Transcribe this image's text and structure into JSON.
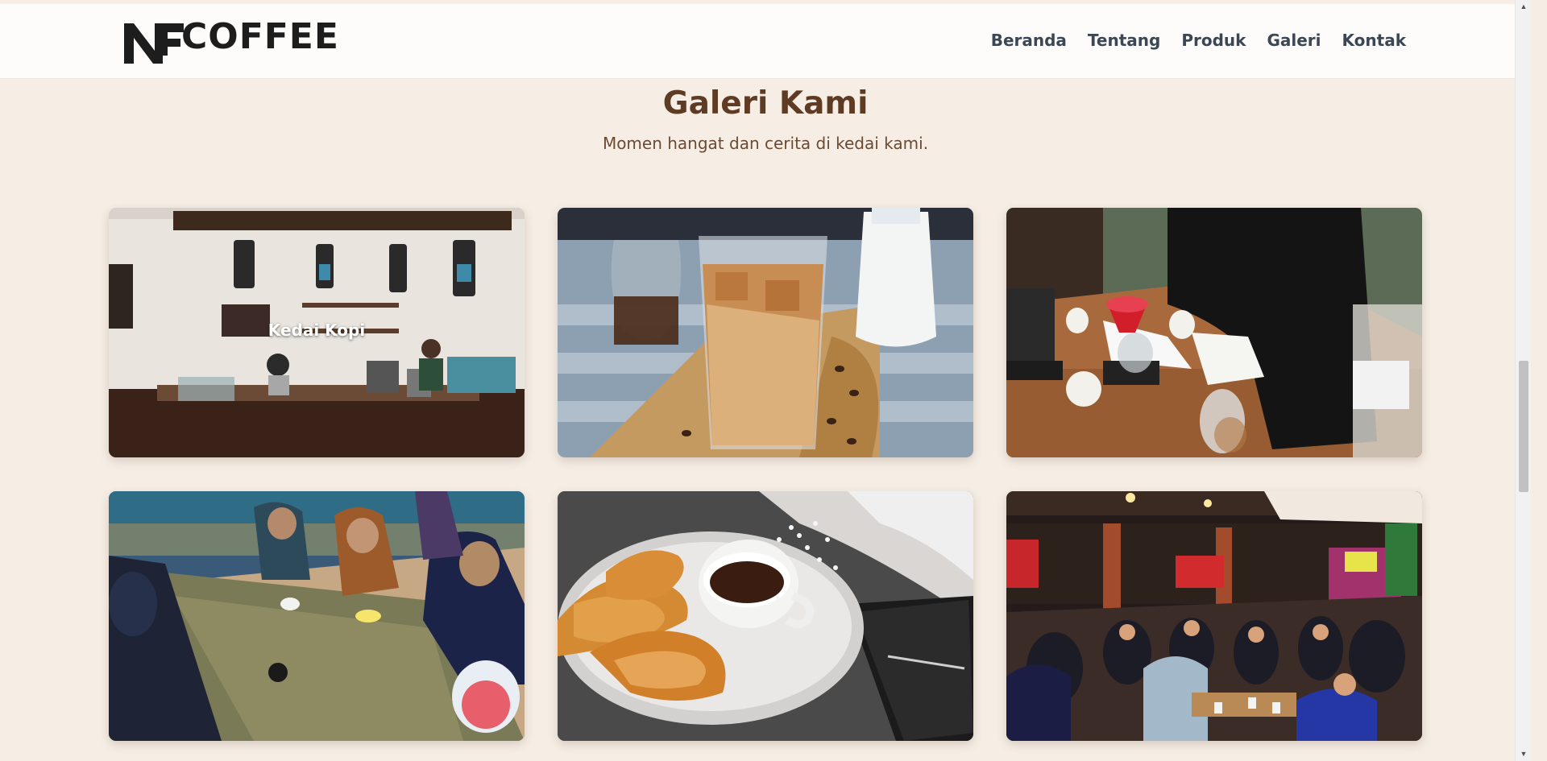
{
  "brand": {
    "logo_text": "COFFEE"
  },
  "nav": {
    "items": [
      {
        "label": "Beranda"
      },
      {
        "label": "Tentang"
      },
      {
        "label": "Produk"
      },
      {
        "label": "Galeri"
      },
      {
        "label": "Kontak"
      }
    ]
  },
  "gallery": {
    "title": "Galeri Kami",
    "subtitle": "Momen hangat dan cerita di kedai kami.",
    "cards": [
      {
        "caption": "Kedai Kopi",
        "image": "coffee-shop-interior"
      },
      {
        "caption": "",
        "image": "iced-coffee-glass"
      },
      {
        "caption": "",
        "image": "pour-over-brewing"
      },
      {
        "caption": "",
        "image": "coffee-bean-sorting"
      },
      {
        "caption": "",
        "image": "coffee-cup-croissants"
      },
      {
        "caption": "",
        "image": "crowded-cafe-night"
      }
    ]
  },
  "colors": {
    "page_bg": "#f6eee5",
    "header_bg": "#fdfcfb",
    "title": "#5e3b22",
    "subtitle": "#6b4a33",
    "nav_text": "#3c4756"
  }
}
